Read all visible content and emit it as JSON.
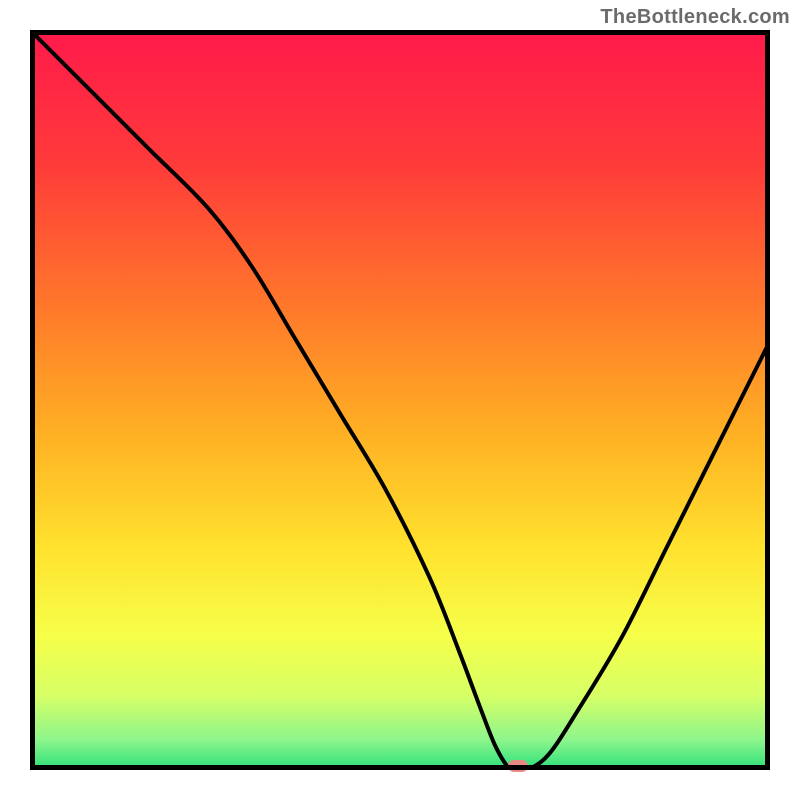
{
  "watermark": "TheBottleneck.com",
  "chart_data": {
    "type": "line",
    "title": "",
    "xlabel": "",
    "ylabel": "",
    "xlim": [
      0,
      100
    ],
    "ylim": [
      0,
      100
    ],
    "series": [
      {
        "name": "bottleneck-curve",
        "x": [
          0,
          8,
          16,
          24,
          30,
          36,
          42,
          48,
          54,
          58,
          61,
          63,
          65,
          67,
          70,
          74,
          80,
          86,
          92,
          100
        ],
        "y": [
          100,
          92,
          84,
          76,
          68,
          58,
          48,
          38,
          26,
          16,
          8,
          3,
          0,
          0,
          2,
          8,
          18,
          30,
          42,
          58
        ]
      }
    ],
    "marker": {
      "x": 66,
      "y": 0,
      "color": "#e88b85"
    },
    "gradient_stops": [
      {
        "offset": 0.0,
        "color": "#ff1a4b"
      },
      {
        "offset": 0.18,
        "color": "#ff3a3a"
      },
      {
        "offset": 0.38,
        "color": "#ff7a2a"
      },
      {
        "offset": 0.55,
        "color": "#ffb224"
      },
      {
        "offset": 0.7,
        "color": "#ffe22e"
      },
      {
        "offset": 0.82,
        "color": "#f6ff4a"
      },
      {
        "offset": 0.9,
        "color": "#d6ff66"
      },
      {
        "offset": 0.96,
        "color": "#8cf58c"
      },
      {
        "offset": 1.0,
        "color": "#2adf7a"
      }
    ]
  }
}
